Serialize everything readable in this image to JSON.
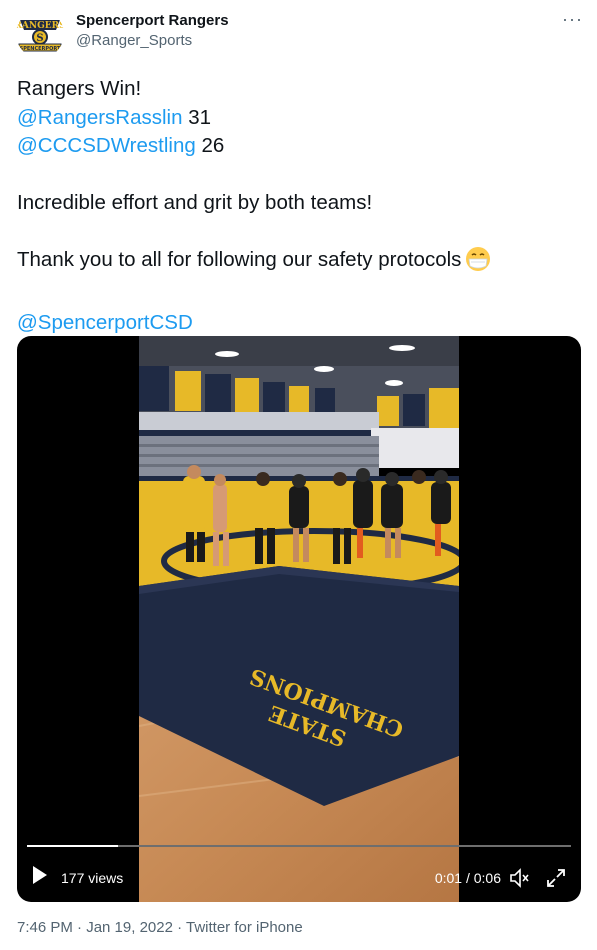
{
  "tweet": {
    "author": {
      "display_name": "Spencerport Rangers",
      "handle": "@Ranger_Sports"
    },
    "more_label": "···",
    "text": {
      "line1": "Rangers Win!",
      "mention1": "@RangersRasslin",
      "score1": "31",
      "mention2": "@CCCSDWrestling",
      "score2": "26",
      "line3": "Incredible effort and grit by both teams!",
      "line4": "Thank you to all for following our safety protocols",
      "emoji": "face-with-medical-mask",
      "mention3": "@SpencerportCSD"
    },
    "video": {
      "views": "177 views",
      "time": "0:01 / 0:06",
      "progress_fraction": 0.1667,
      "mat_text_line1": "STATE",
      "mat_text_line2": "CHAMPIONS"
    },
    "timestamp": "7:46 PM · Jan 19, 2022 · Twitter for iPhone"
  },
  "colors": {
    "link": "#1d9bf0",
    "secondary_text": "#536471",
    "mat": "#1f2a44",
    "gold": "#e7b928"
  }
}
